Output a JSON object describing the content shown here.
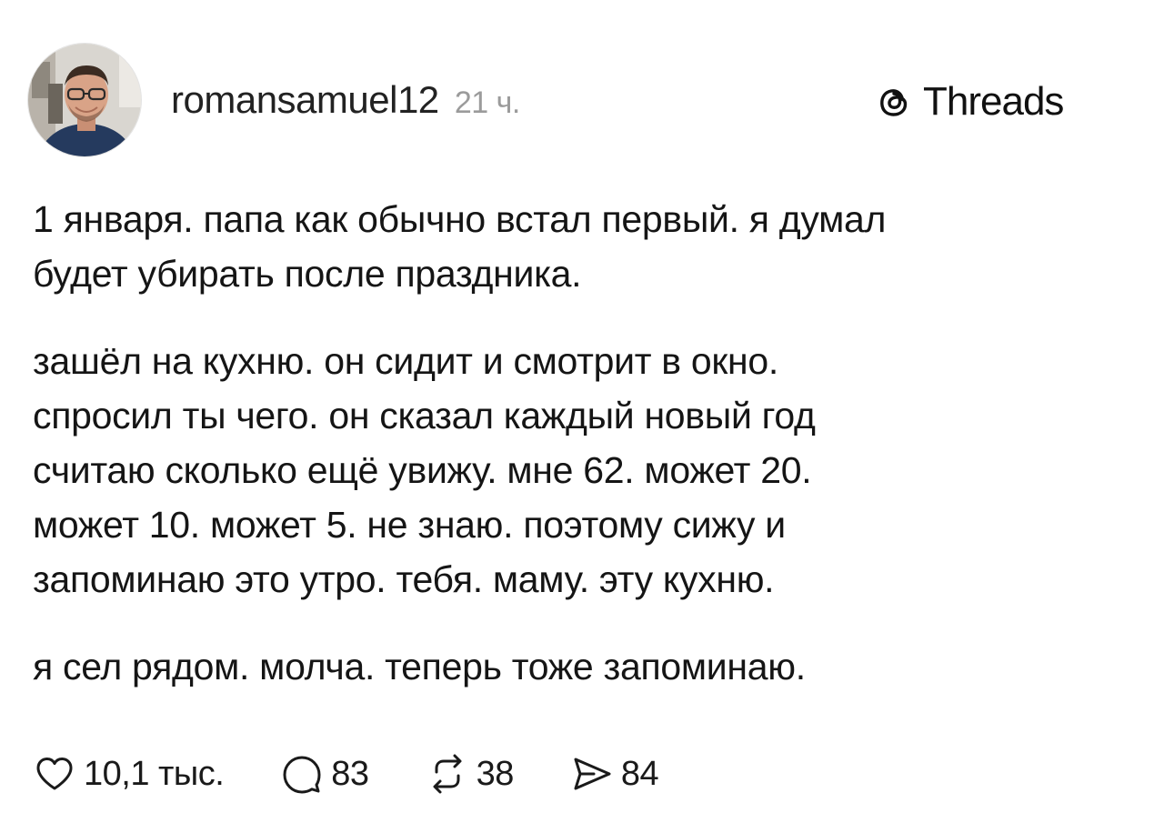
{
  "post": {
    "author": {
      "username": "romansamuel12",
      "time_ago": "21 ч."
    },
    "brand": {
      "name": "Threads",
      "icon": "threads-logo-icon"
    },
    "paragraphs": [
      {
        "lines": [
          "1 января. папа как обычно встал первый. я думал",
          "будет убирать после праздника."
        ]
      },
      {
        "lines": [
          "зашёл на кухню. он сидит и смотрит в окно.",
          "спросил ты чего. он сказал каждый новый год",
          "считаю сколько ещё увижу. мне 62. может 20.",
          "может 10. может 5. не знаю. поэтому сижу и",
          "запоминаю это утро. тебя. маму. эту кухню."
        ]
      },
      {
        "lines": [
          "я сел рядом. молча. теперь тоже запоминаю."
        ]
      }
    ],
    "actions": {
      "like": {
        "icon": "heart-icon",
        "count": "10,1 тыс."
      },
      "reply": {
        "icon": "comment-icon",
        "count": "83"
      },
      "repost": {
        "icon": "repost-icon",
        "count": "38"
      },
      "share": {
        "icon": "send-icon",
        "count": "84"
      }
    },
    "colors": {
      "text": "#151515",
      "muted": "#9b9b9b",
      "background": "#ffffff"
    }
  }
}
